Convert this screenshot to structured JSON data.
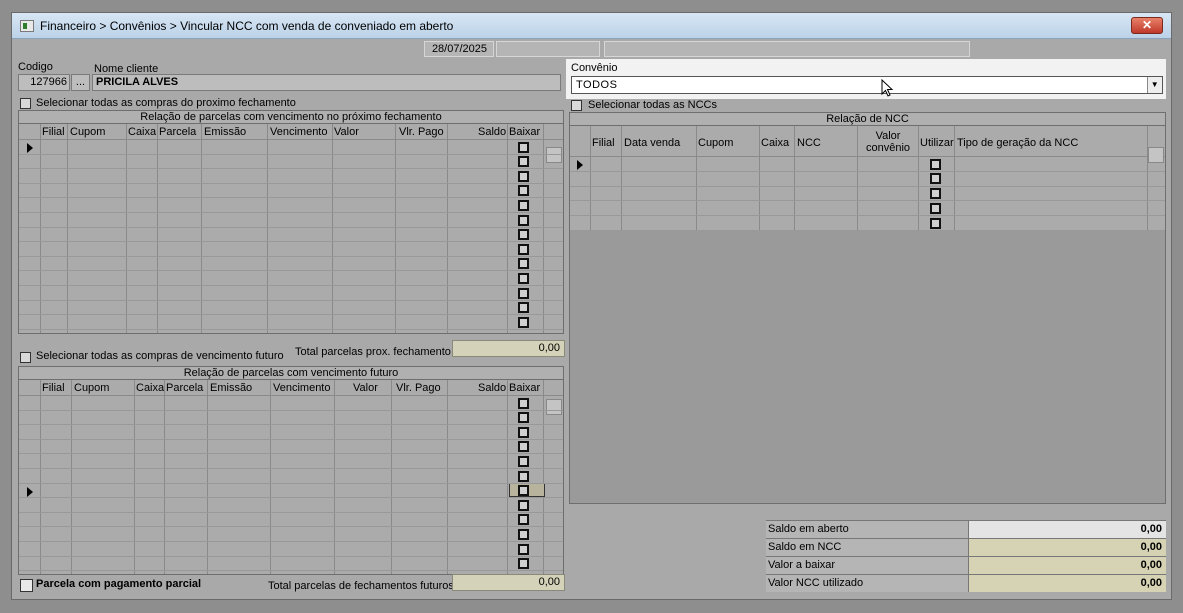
{
  "window": {
    "title": "Financeiro > Convênios > Vincular NCC com venda de conveniado em aberto",
    "close_label": "✕",
    "date": "28/07/2025"
  },
  "client": {
    "code_label": "Codigo",
    "code_value": "127966",
    "lookup_label": "...",
    "name_label": "Nome cliente",
    "name_value": "PRICILA ALVES"
  },
  "convenio": {
    "label": "Convênio",
    "selected": "TODOS"
  },
  "next_closing": {
    "select_all_label": "Selecionar todas as compras do proximo fechamento",
    "grid_title": "Relação de parcelas com vencimento no próximo fechamento",
    "columns": [
      "Filial",
      "Cupom",
      "Caixa",
      "Parcela",
      "Emissão",
      "Vencimento",
      "Valor",
      "Vlr. Pago",
      "Saldo",
      "Baixar"
    ],
    "total_label": "Total parcelas prox. fechamento",
    "total_value": "0,00"
  },
  "future": {
    "select_all_label": "Selecionar todas as compras de vencimento futuro",
    "grid_title": "Relação de parcelas com vencimento futuro",
    "columns": [
      "Filial",
      "Cupom",
      "Caixa",
      "Parcela",
      "Emissão",
      "Vencimento",
      "Valor",
      "Vlr. Pago",
      "Saldo",
      "Baixar"
    ],
    "total_label": "Total parcelas de fechamentos futuros",
    "total_value": "0,00",
    "partial_label": "Parcela com pagamento parcial"
  },
  "ncc": {
    "select_all_label": "Selecionar todas as NCCs",
    "grid_title": "Relação de NCC",
    "columns": [
      "Filial",
      "Data venda",
      "Cupom",
      "Caixa",
      "NCC",
      "Valor convênio",
      "Utilizar",
      "Tipo de geração da NCC"
    ]
  },
  "summary": {
    "rows": [
      {
        "label": "Saldo em aberto",
        "value": "0,00"
      },
      {
        "label": "Saldo em NCC",
        "value": "0,00"
      },
      {
        "label": "Valor a baixar",
        "value": "0,00"
      },
      {
        "label": "Valor NCC utilizado",
        "value": "0,00"
      }
    ]
  }
}
